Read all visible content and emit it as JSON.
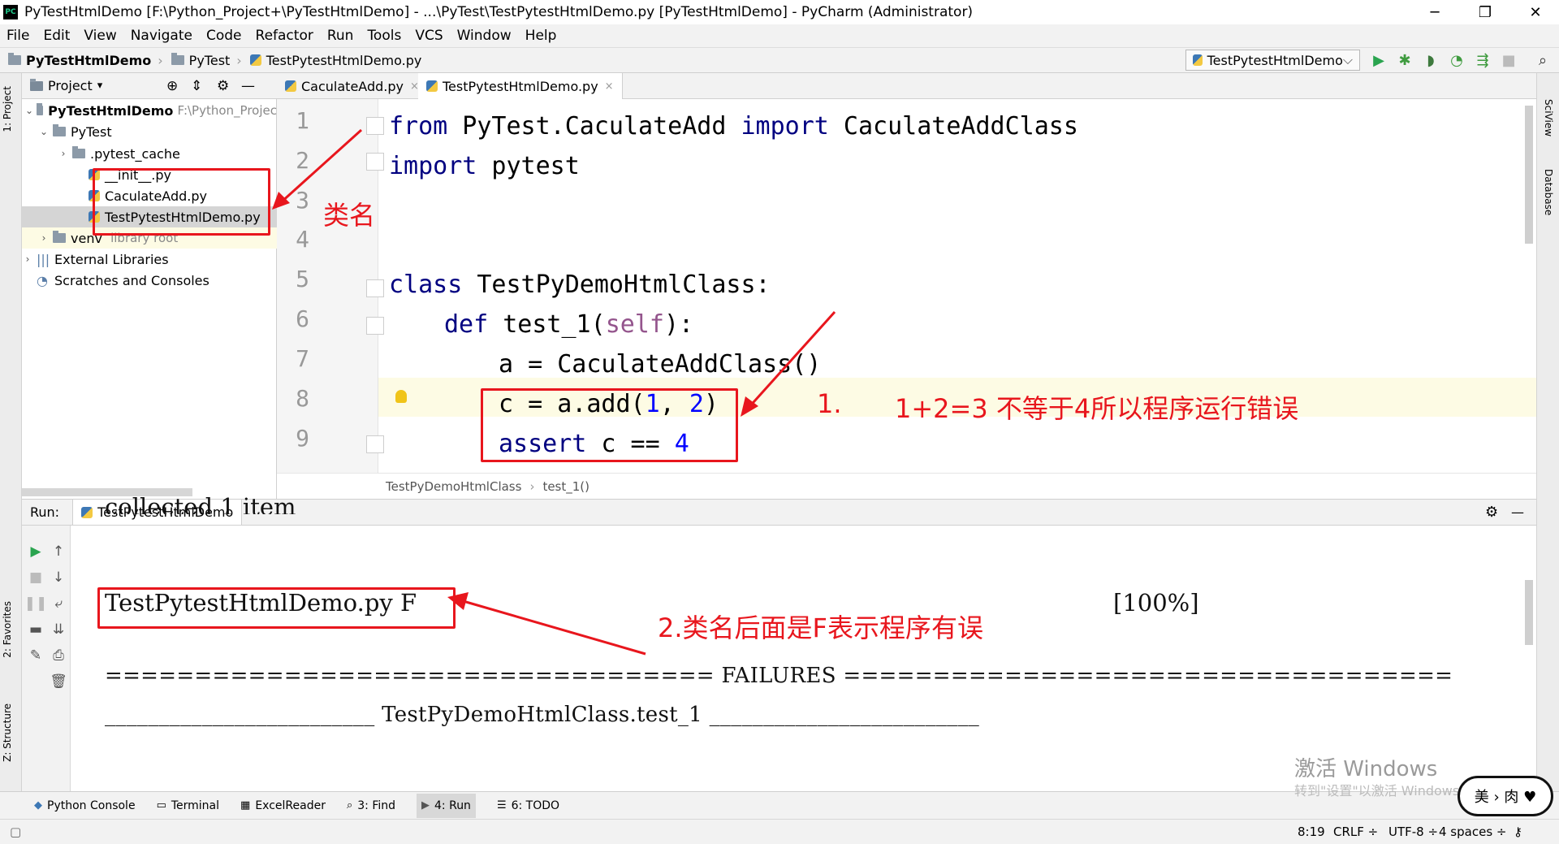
{
  "window": {
    "app_badge": "PC",
    "title": "PyTestHtmlDemo [F:\\Python_Project+\\PyTestHtmlDemo] - ...\\PyTest\\TestPytestHtmlDemo.py [PyTestHtmlDemo] - PyCharm (Administrator)",
    "minimize": "─",
    "restore": "❐",
    "close": "✕"
  },
  "menu": [
    {
      "label": "File"
    },
    {
      "label": "Edit"
    },
    {
      "label": "View"
    },
    {
      "label": "Navigate"
    },
    {
      "label": "Code"
    },
    {
      "label": "Refactor"
    },
    {
      "label": "Run"
    },
    {
      "label": "Tools"
    },
    {
      "label": "VCS"
    },
    {
      "label": "Window"
    },
    {
      "label": "Help"
    }
  ],
  "navbar": {
    "crumbs": [
      "PyTestHtmlDemo",
      "PyTest",
      "TestPytestHtmlDemo.py"
    ],
    "run_config": "TestPytestHtmlDemo",
    "run_config_chevron": "⌵"
  },
  "toolbar_icons": {
    "run": "▶",
    "debug": "✱",
    "coverage": "◗",
    "profile": "◔",
    "concurrency": "⇶",
    "stop": "■",
    "search": "⌕"
  },
  "side_tabs": {
    "left_project": "1: Project",
    "left_favorites": "2: Favorites",
    "left_structure": "Z: Structure",
    "right_sciview": "SciView",
    "right_database": "Database"
  },
  "project_panel": {
    "header": "Project",
    "header_chevron": "▾",
    "tools": [
      "⊕",
      "⇕",
      "⚙",
      "—"
    ],
    "tree": [
      {
        "label": "PyTestHtmlDemo",
        "extra": "F:\\Python_Projec"
      },
      {
        "label": "PyTest"
      },
      {
        "label": ".pytest_cache"
      },
      {
        "label": "__init__.py"
      },
      {
        "label": "CaculateAdd.py"
      },
      {
        "label": "TestPytestHtmlDemo.py"
      },
      {
        "label": "venv",
        "extra": "library root"
      },
      {
        "label": "External Libraries"
      },
      {
        "label": "Scratches and Consoles"
      }
    ]
  },
  "editor": {
    "tabs": [
      {
        "label": "CaculateAdd.py",
        "close": "×"
      },
      {
        "label": "TestPytestHtmlDemo.py",
        "close": "×"
      }
    ],
    "line_numbers": [
      "1",
      "2",
      "3",
      "4",
      "5",
      "6",
      "7",
      "8",
      "9"
    ],
    "code": {
      "l1_kw1": "from",
      "l1_mod": " PyTest.CaculateAdd ",
      "l1_kw2": "import",
      "l1_cls": " CaculateAddClass",
      "l2_kw": "import",
      "l2_mod": " pytest",
      "l5_kw": "class",
      "l5_rest": " TestPyDemoHtmlClass:",
      "l6_kw": "def",
      "l6_name": " test_1(",
      "l6_self": "self",
      "l6_end": "):",
      "l7": "a = CaculateAddClass()",
      "l8_a": "c = a.add(",
      "l8_n1": "1",
      "l8_b": ", ",
      "l8_n2": "2",
      "l8_c": ")",
      "l9_kw": "assert",
      "l9_mid": " c == ",
      "l9_num": "4"
    },
    "breadcrumb": [
      "TestPyDemoHtmlClass",
      "test_1()"
    ],
    "breadcrumb_sep": "›"
  },
  "run_panel": {
    "label": "Run:",
    "tab": "TestPytestHtmlDemo",
    "settings": "⚙",
    "hide": "—",
    "output": {
      "collected": "collected 1 item",
      "result_line": "TestPytestHtmlDemo.py F",
      "percent": "[100%]",
      "failures": "================================== FAILURES ==================================",
      "test_header": "_________________________ TestPyDemoHtmlClass.test_1 _________________________"
    }
  },
  "bottom_tabs": [
    {
      "label": "Python Console",
      "icon": "◆"
    },
    {
      "label": "Terminal",
      "icon": "▭"
    },
    {
      "label": "ExcelReader",
      "icon": "▦"
    },
    {
      "label": "3: Find",
      "icon": "⌕"
    },
    {
      "label": "4: Run",
      "icon": "▶"
    },
    {
      "label": "6: TODO",
      "icon": "☰"
    }
  ],
  "status_bar": {
    "position": "8:19",
    "line_sep": "CRLF ÷",
    "encoding": "UTF-8 ÷",
    "indent": "4 spaces ÷",
    "lock": "⚷",
    "layout_icon": "▢"
  },
  "annotations": {
    "class_name": "类名",
    "note1_num": "1.",
    "note1_text": "1+2=3 不等于4所以程序运行错误",
    "note2": "2.类名后面是F表示程序有误",
    "color": "#e8161d"
  },
  "watermark": {
    "line1": "激活 Windows",
    "line2": "转到\"设置\"以激活 Windows。"
  },
  "signature": "美 › 肉 ♥"
}
